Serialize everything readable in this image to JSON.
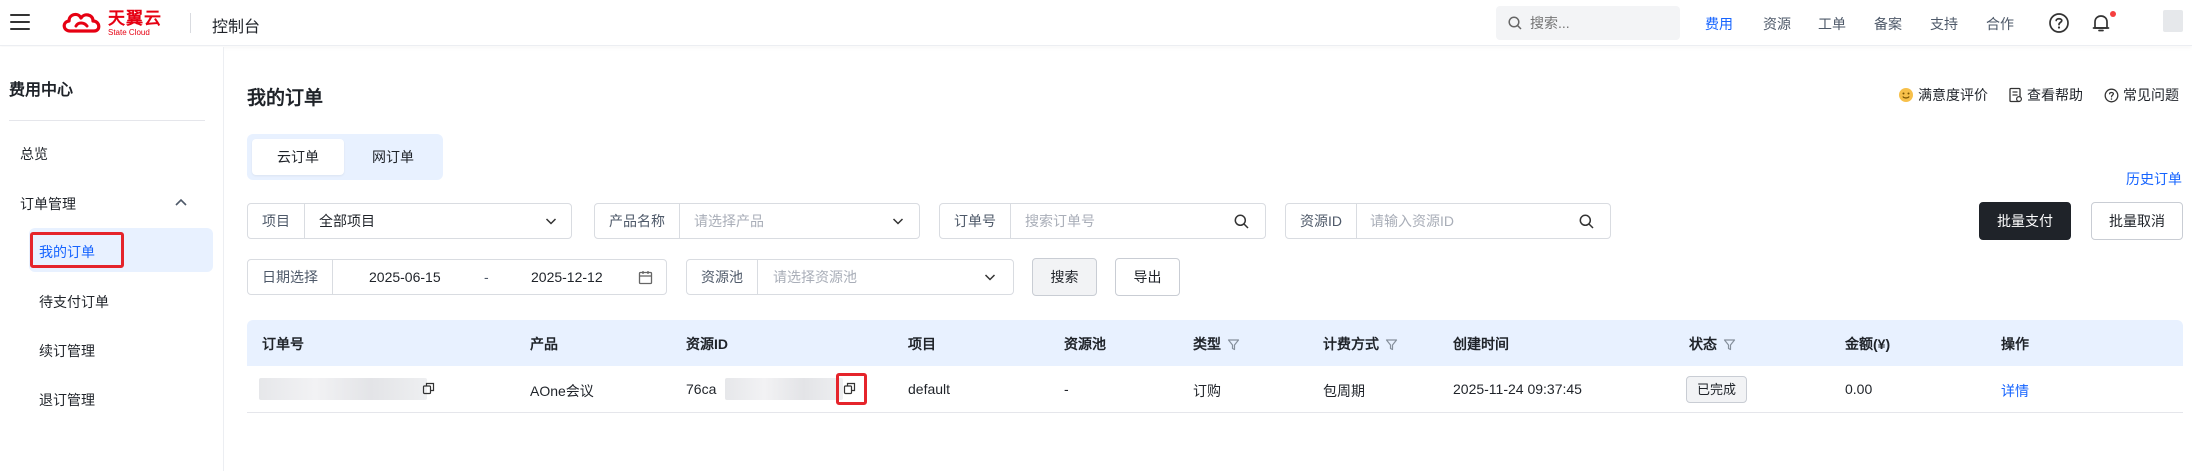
{
  "header": {
    "logo_cn": "天翼云",
    "logo_en": "State Cloud",
    "console": "控制台",
    "search_placeholder": "搜索...",
    "nav": [
      "费用",
      "资源",
      "工单",
      "备案",
      "支持",
      "合作"
    ],
    "active_nav": "费用",
    "icons": [
      "help-circle-icon",
      "bell-icon"
    ]
  },
  "sidebar": {
    "title": "费用中心",
    "items": [
      "总览",
      "订单管理",
      "我的订单",
      "待支付订单",
      "续订管理",
      "退订管理"
    ],
    "active": "我的订单"
  },
  "main": {
    "title": "我的订单",
    "top_links": [
      "满意度评价",
      "查看帮助",
      "常见问题"
    ],
    "tabs": [
      "云订单",
      "网订单"
    ],
    "active_tab": "云订单",
    "history_link": "历史订单",
    "filters": {
      "project_label": "项目",
      "project_value": "全部项目",
      "product_label": "产品名称",
      "product_placeholder": "请选择产品",
      "order_label": "订单号",
      "order_placeholder": "搜索订单号",
      "resource_label": "资源ID",
      "resource_placeholder": "请输入资源ID",
      "date_label": "日期选择",
      "date_start": "2025-06-15",
      "date_sep": "-",
      "date_end": "2025-12-12",
      "pool_label": "资源池",
      "pool_placeholder": "请选择资源池"
    },
    "buttons": {
      "search": "搜索",
      "export": "导出",
      "batch_pay": "批量支付",
      "batch_cancel": "批量取消"
    }
  },
  "table": {
    "columns": [
      "订单号",
      "产品",
      "资源ID",
      "项目",
      "资源池",
      "类型",
      "计费方式",
      "创建时间",
      "状态",
      "金额(¥)",
      "操作"
    ],
    "rows": [
      {
        "product": "AOne会议",
        "resource_id_prefix": "76ca",
        "project": "default",
        "pool": "-",
        "type": "订购",
        "billing": "包周期",
        "created": "2025-11-24 09:37:45",
        "status": "已完成",
        "amount": "0.00",
        "action": "详情"
      }
    ]
  },
  "colors": {
    "brand_red": "#e60012",
    "accent_blue": "#1664ff",
    "highlight_red": "#e5242b"
  }
}
